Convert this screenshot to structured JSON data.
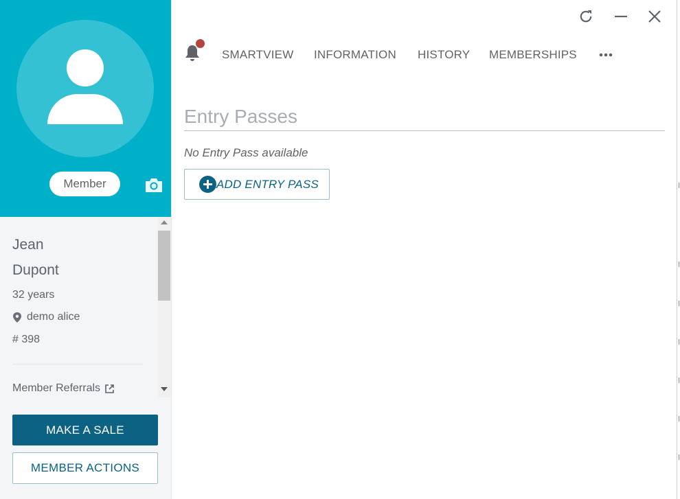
{
  "profile": {
    "badge": "Member",
    "first_name": "Jean",
    "last_name": "Dupont",
    "age": "32 years",
    "location": "demo alice",
    "member_number": "# 398",
    "referrals_link": "Member Referrals"
  },
  "actions": {
    "make_sale": "MAKE A SALE",
    "member_actions": "MEMBER ACTIONS"
  },
  "tabs": {
    "smartview": "SMARTVIEW",
    "information": "INFORMATION",
    "history": "HISTORY",
    "memberships": "MEMBERSHIPS"
  },
  "section": {
    "title": "Entry Passes",
    "empty_message": "No Entry Pass available",
    "add_button": "ADD ENTRY PASS"
  },
  "icons": [
    "person-avatar-icon",
    "camera-icon",
    "map-pin-icon",
    "external-link-icon",
    "bell-icon",
    "more-icon",
    "refresh-icon",
    "minimize-icon",
    "close-icon",
    "plus-circle-icon"
  ],
  "colors": {
    "header_teal": "#00b0c8",
    "primary_blue": "#0b6283",
    "notification_red": "#b5443c"
  }
}
